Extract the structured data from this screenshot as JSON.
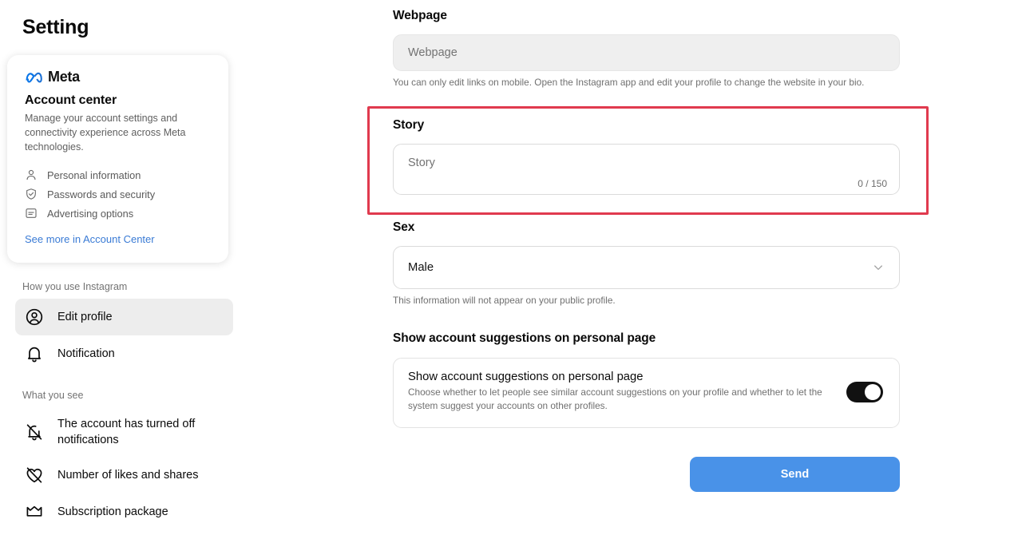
{
  "sidebar": {
    "title": "Setting",
    "account_card": {
      "brand": "Meta",
      "heading": "Account center",
      "description": "Manage your account settings and connectivity experience across Meta technologies.",
      "links": [
        {
          "label": "Personal information",
          "icon": "person-icon"
        },
        {
          "label": "Passwords and security",
          "icon": "shield-check-icon"
        },
        {
          "label": "Advertising options",
          "icon": "advertising-icon"
        }
      ],
      "see_more": "See more in Account Center",
      "link_color": "#3a7bd5"
    },
    "sections": [
      {
        "heading": "How you use Instagram",
        "items": [
          {
            "label": "Edit profile",
            "icon": "profile-circle-icon",
            "active": true
          },
          {
            "label": "Notification",
            "icon": "bell-icon",
            "active": false
          }
        ]
      },
      {
        "heading": "What you see",
        "items": [
          {
            "label": "The account has turned off notifications",
            "icon": "bell-slash-icon",
            "active": false
          },
          {
            "label": "Number of likes and shares",
            "icon": "heart-slash-icon",
            "active": false
          },
          {
            "label": "Subscription package",
            "icon": "crown-icon",
            "active": false
          }
        ]
      }
    ]
  },
  "main": {
    "webpage": {
      "title": "Webpage",
      "value": "",
      "placeholder": "Webpage",
      "helper": "You can only edit links on mobile. Open the Instagram app and edit your profile to change the website in your bio."
    },
    "story": {
      "title": "Story",
      "value": "",
      "placeholder": "Story",
      "counter": "0 / 150"
    },
    "sex": {
      "title": "Sex",
      "selected": "Male",
      "options": [
        "Male"
      ],
      "helper": "This information will not appear on your public profile.",
      "chevron": "chevron-down-icon"
    },
    "suggestions": {
      "title": "Show account suggestions on personal page",
      "card_title": "Show account suggestions on personal page",
      "card_desc": "Choose whether to let people see similar account suggestions on your profile and whether to let the system suggest your accounts on other profiles.",
      "toggle_on": true,
      "toggle_color": "#111111"
    },
    "send_button": "Send",
    "send_button_color": "#4992e8"
  },
  "annotation": {
    "highlight_color": "#e03a4e"
  }
}
